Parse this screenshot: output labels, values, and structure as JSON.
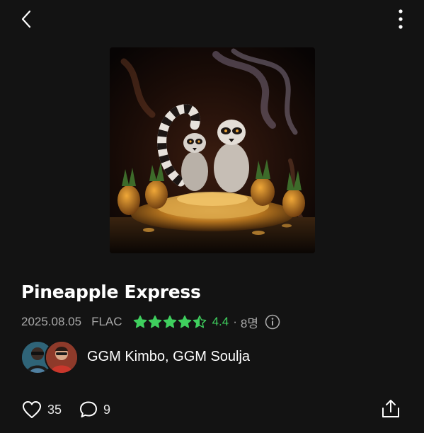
{
  "header": {
    "back_icon": "chevron-left-icon",
    "more_icon": "more-vertical-icon"
  },
  "album": {
    "cover_description": "",
    "title": "Pineapple Express",
    "release_date": "2025.08.05",
    "format": "FLAC",
    "rating": {
      "stars_filled": 4.5,
      "stars_total": 5,
      "score": "4.4",
      "separator": "·",
      "count": "8명",
      "star_color": "#3fcf5e"
    },
    "artists": {
      "names": "GGM Kimbo, GGM Soulja"
    }
  },
  "actions": {
    "likes": "35",
    "comments": "9",
    "like_icon": "heart-icon",
    "comment_icon": "comment-bubble-icon",
    "share_icon": "share-icon"
  },
  "colors": {
    "background": "#131313",
    "accent": "#3fcf5e",
    "text_secondary": "#a9a9a9"
  }
}
